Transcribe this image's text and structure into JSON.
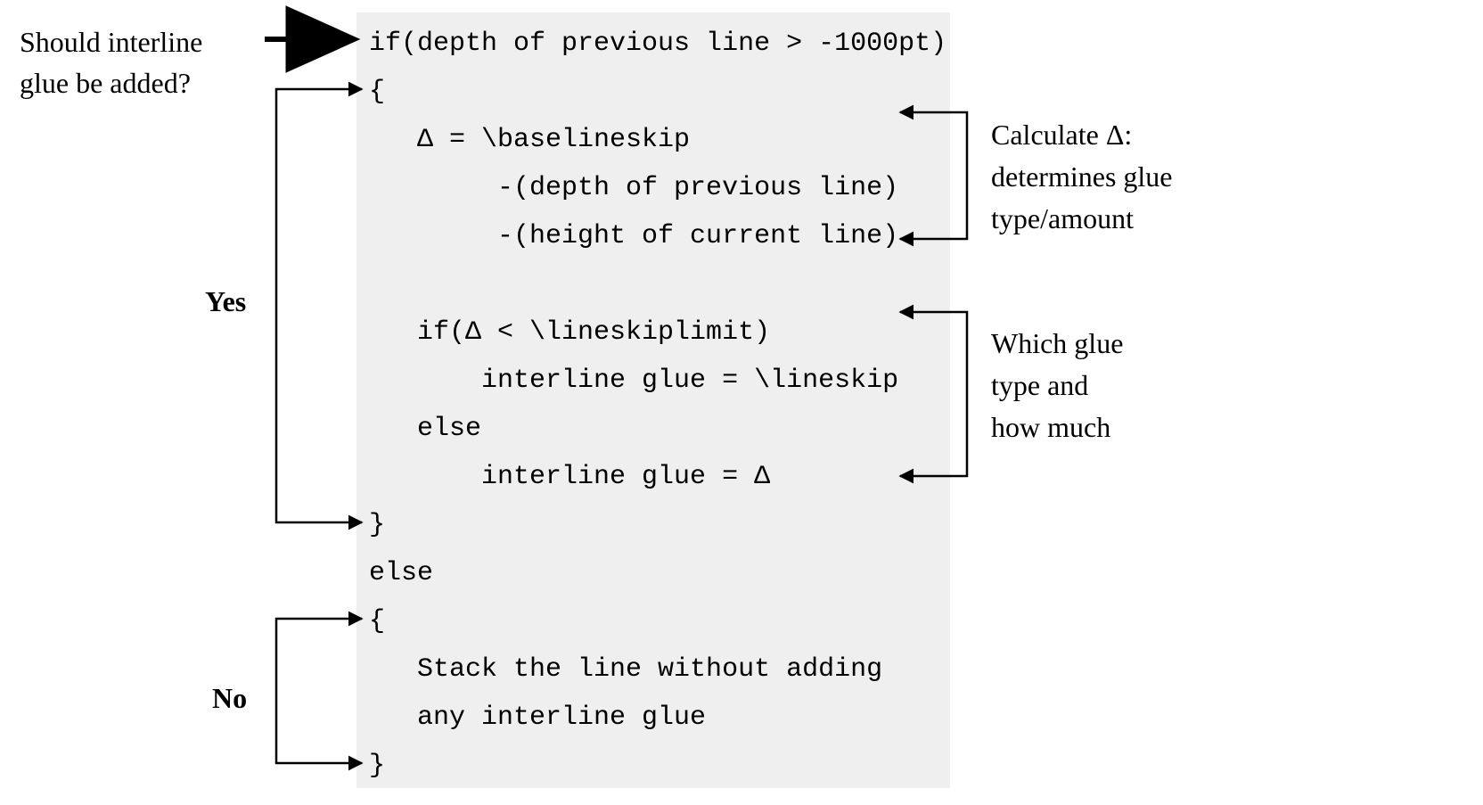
{
  "annotations": {
    "question_l1": "Should interline",
    "question_l2": "glue be added?",
    "yes": "Yes",
    "no": "No",
    "calc_l1": "Calculate Δ:",
    "calc_l2": "determines glue",
    "calc_l3": "type/amount",
    "which_l1": "Which glue",
    "which_l2": "type and",
    "which_l3": "how much"
  },
  "code": {
    "l1": "if(depth of previous line > -1000pt)",
    "l2": "{",
    "l3": "   Δ = \\baselineskip",
    "l4": "        -(depth of previous line)",
    "l5": "        -(height of current line)",
    "l6": "",
    "l7": "   if(Δ < \\lineskiplimit)",
    "l8": "       interline glue = \\lineskip",
    "l9": "   else",
    "l10": "       interline glue = Δ",
    "l11": "}",
    "l12": "else",
    "l13": "{",
    "l14": "   Stack the line without adding",
    "l15": "   any interline glue",
    "l16": "}"
  }
}
